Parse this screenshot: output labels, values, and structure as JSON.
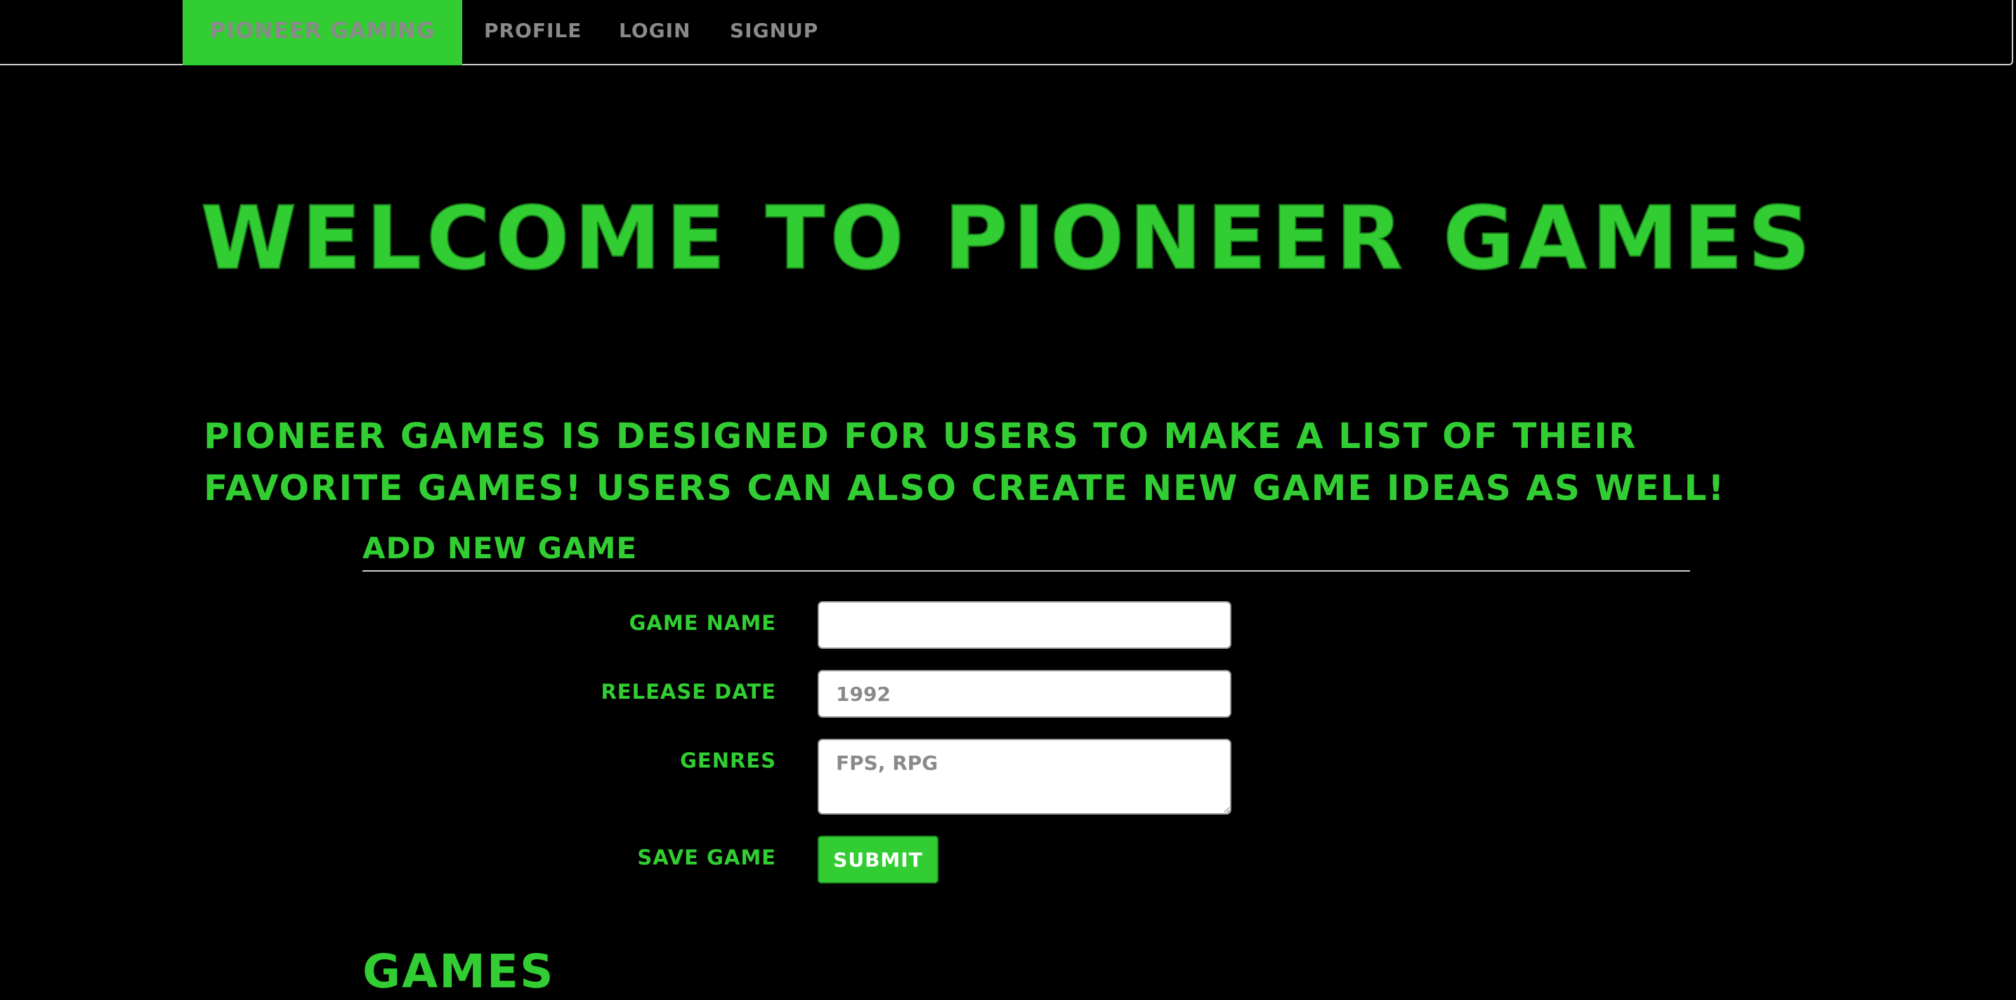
{
  "nav": {
    "brand": "Pioneer Gaming",
    "links": [
      "Profile",
      "Login",
      "Signup"
    ]
  },
  "hero": {
    "title": "Welcome to Pioneer Games"
  },
  "intro": {
    "text": "Pioneer Games is designed for users to make a list of their favorite games! Users can also create new game ideas as well!"
  },
  "form": {
    "title": "Add New Game",
    "game_name": {
      "label": "Game Name",
      "value": "",
      "placeholder": ""
    },
    "release_date": {
      "label": "Release Date",
      "value": "",
      "placeholder": "1992"
    },
    "genres": {
      "label": "Genres",
      "value": "",
      "placeholder": "FPS, RPG"
    },
    "save": {
      "label": "Save Game",
      "button": "Submit"
    }
  },
  "games": {
    "title": "Games"
  },
  "colors": {
    "accent": "#32cd32",
    "background": "#000000",
    "nav_text": "#8a8a8a"
  }
}
